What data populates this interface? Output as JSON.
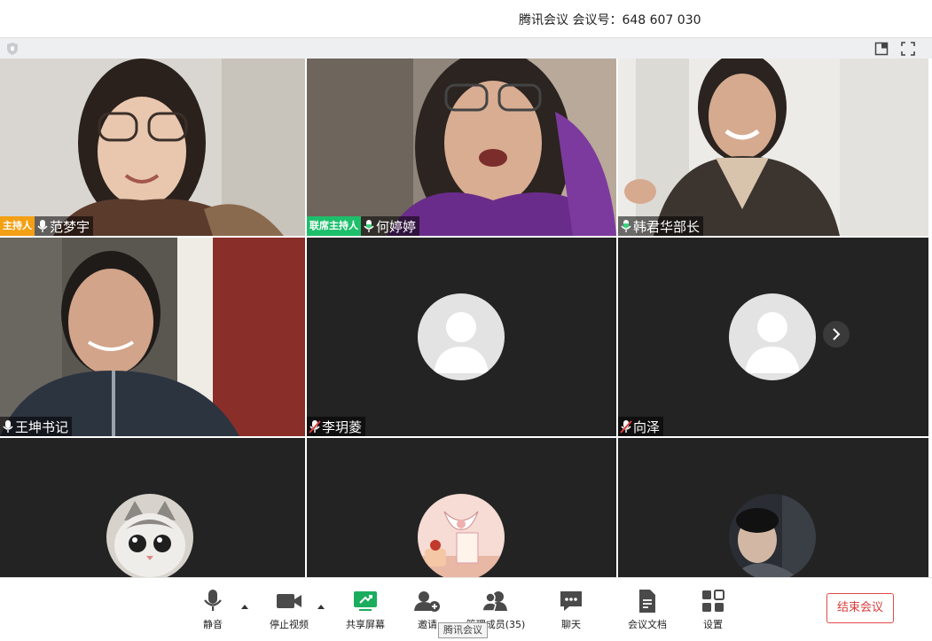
{
  "window": {
    "title": "腾讯会议 会议号：648 607 030"
  },
  "icons": {
    "shield": "shield-icon",
    "layout": "layout-switch-icon",
    "fullscreen": "fullscreen-icon",
    "mic": "microphone-icon",
    "mic_muted": "microphone-muted-icon",
    "next": "chevron-right-icon"
  },
  "participants": [
    {
      "name": "范梦宇",
      "role": "主持人",
      "mic": "on",
      "video": "on"
    },
    {
      "name": "何婷婷",
      "role": "联席主持人",
      "mic": "speaking",
      "video": "on"
    },
    {
      "name": "韩君华部长",
      "role": "",
      "mic": "speaking",
      "video": "on"
    },
    {
      "name": "王坤书记",
      "role": "",
      "mic": "on",
      "video": "on"
    },
    {
      "name": "李玥菱",
      "role": "",
      "mic": "muted",
      "video": "off"
    },
    {
      "name": "向泽",
      "role": "",
      "mic": "muted",
      "video": "off"
    },
    {
      "name": "",
      "role": "",
      "video": "off",
      "avatar": "cat"
    },
    {
      "name": "",
      "role": "",
      "video": "off",
      "avatar": "cake"
    },
    {
      "name": "",
      "role": "",
      "video": "off",
      "avatar": "photo"
    }
  ],
  "toolbar": {
    "mute": "静音",
    "stop_video": "停止视频",
    "share_screen": "共享屏幕",
    "invite": "邀请",
    "manage_members": "管理成员(35)",
    "chat": "聊天",
    "docs": "会议文档",
    "settings": "设置",
    "end_meeting": "结束会议"
  },
  "tooltip": "腾讯会议",
  "colors": {
    "host_badge": "#f3a014",
    "cohost_badge": "#1dbf6b",
    "share_green": "#1aad5d",
    "end_red": "#e24a4a",
    "tile_bg": "#232323"
  }
}
